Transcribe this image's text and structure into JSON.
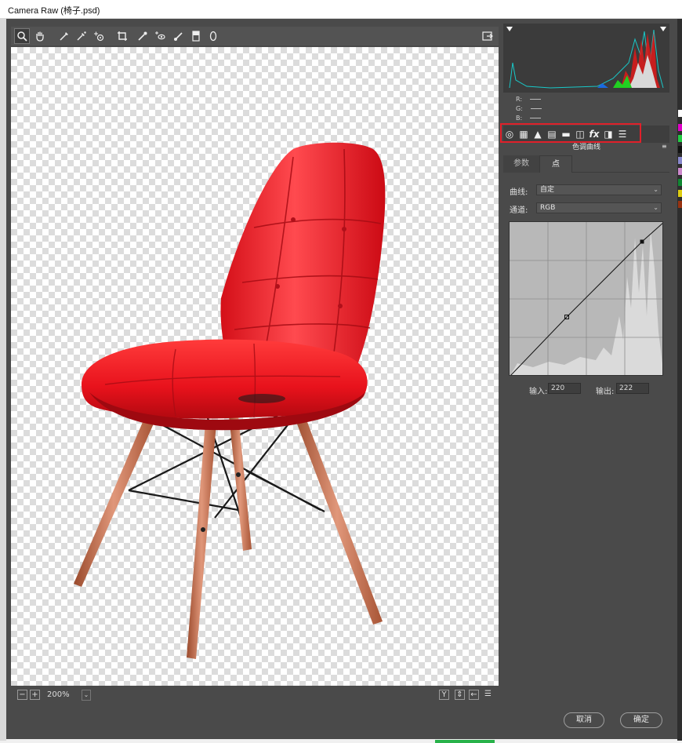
{
  "window": {
    "title": "Camera Raw (椅子.psd)"
  },
  "toolbar": {
    "tools": [
      "zoom-tool",
      "hand-tool",
      "white-balance-tool",
      "color-sampler-tool",
      "targeted-adjustment-tool",
      "crop-tool",
      "straighten-tool",
      "spot-removal-tool",
      "red-eye-removal-tool",
      "adjustment-brush-tool",
      "graduated-filter-tool",
      "radial-filter-tool"
    ],
    "open_preferences_icon": "export-icon"
  },
  "status": {
    "zoom": "200%"
  },
  "rgb_readout": {
    "r_label": "R:",
    "g_label": "G:",
    "b_label": "B:"
  },
  "panel": {
    "title": "色调曲线",
    "tabs": [
      {
        "label": "参数"
      },
      {
        "label": "点"
      }
    ],
    "curve_label": "曲线:",
    "curve_value": "自定",
    "channel_label": "通道:",
    "channel_value": "RGB",
    "input_label": "输入:",
    "input_value": "220",
    "output_label": "输出:",
    "output_value": "222"
  },
  "footer": {
    "cancel": "取消",
    "ok": "确定"
  },
  "colors": {
    "highlight_box": "#e0202a",
    "chair": "#e8121c",
    "frame": "#4a4a4a"
  }
}
